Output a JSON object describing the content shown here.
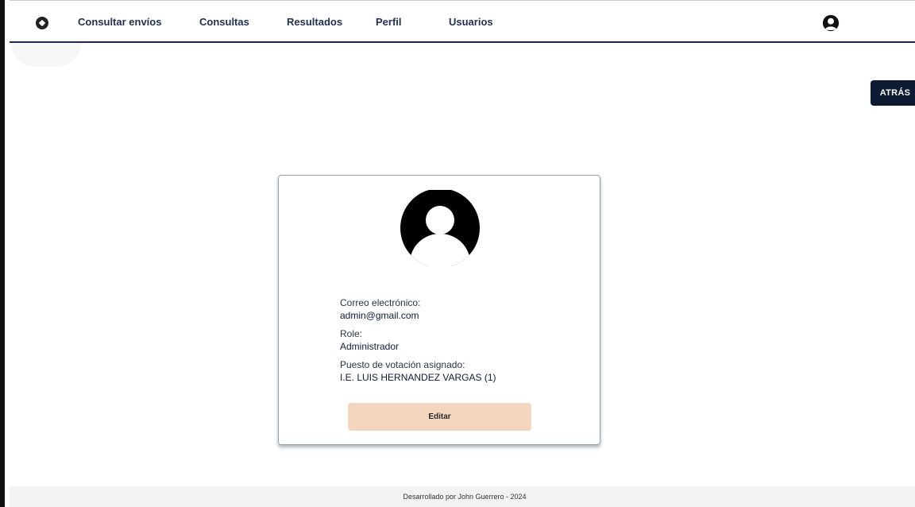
{
  "nav": {
    "logo_icon": "compass-icon",
    "items": [
      {
        "label": "Consultar envíos"
      },
      {
        "label": "Consultas"
      },
      {
        "label": "Resultados"
      },
      {
        "label": "Perfil"
      },
      {
        "label": "Usuarios"
      }
    ],
    "avatar_icon": "user-avatar-icon"
  },
  "back_button": {
    "label": "ATRÁS"
  },
  "profile": {
    "avatar_icon": "user-avatar-icon",
    "email_label": "Correo electrónico:",
    "email_value": "admin@gmail.com",
    "role_label": "Role:",
    "role_value": "Administrador",
    "station_label": "Puesto de votación asignado:",
    "station_value": "I.E. LUIS HERNANDEZ VARGAS (1)",
    "edit_label": "Editar"
  },
  "footer": {
    "text": "Desarrollado por John Guerrero - 2024"
  },
  "colors": {
    "nav_text": "#23314f",
    "back_button_bg": "#0d1a33",
    "edit_button_bg": "#f2d6bf",
    "footer_bg": "#f2f2f3"
  }
}
